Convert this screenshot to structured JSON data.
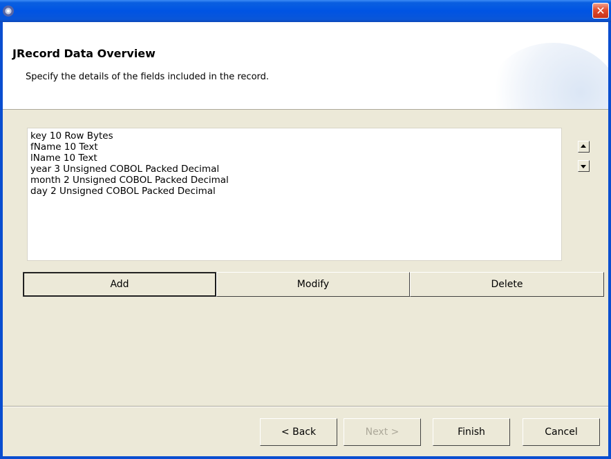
{
  "window": {
    "close_glyph": "✕",
    "icon": "eclipse-icon"
  },
  "banner": {
    "title": "JRecord Data Overview",
    "description": "Specify the details of the fields included in the record."
  },
  "fields_list": {
    "items": [
      "key 10 Row Bytes",
      "fName 10 Text",
      "lName 10 Text",
      "year 3 Unsigned COBOL Packed Decimal",
      "month 2 Unsigned COBOL Packed Decimal",
      "day 2 Unsigned COBOL Packed Decimal"
    ]
  },
  "actions": {
    "add_label": "Add",
    "modify_label": "Modify",
    "delete_label": "Delete"
  },
  "navigation": {
    "back_label": "< Back",
    "next_label": "Next >",
    "finish_label": "Finish",
    "cancel_label": "Cancel"
  },
  "colors": {
    "titlebar": "#0054e3",
    "dialog_bg": "#ece9d8",
    "disabled_text": "#aca899"
  }
}
